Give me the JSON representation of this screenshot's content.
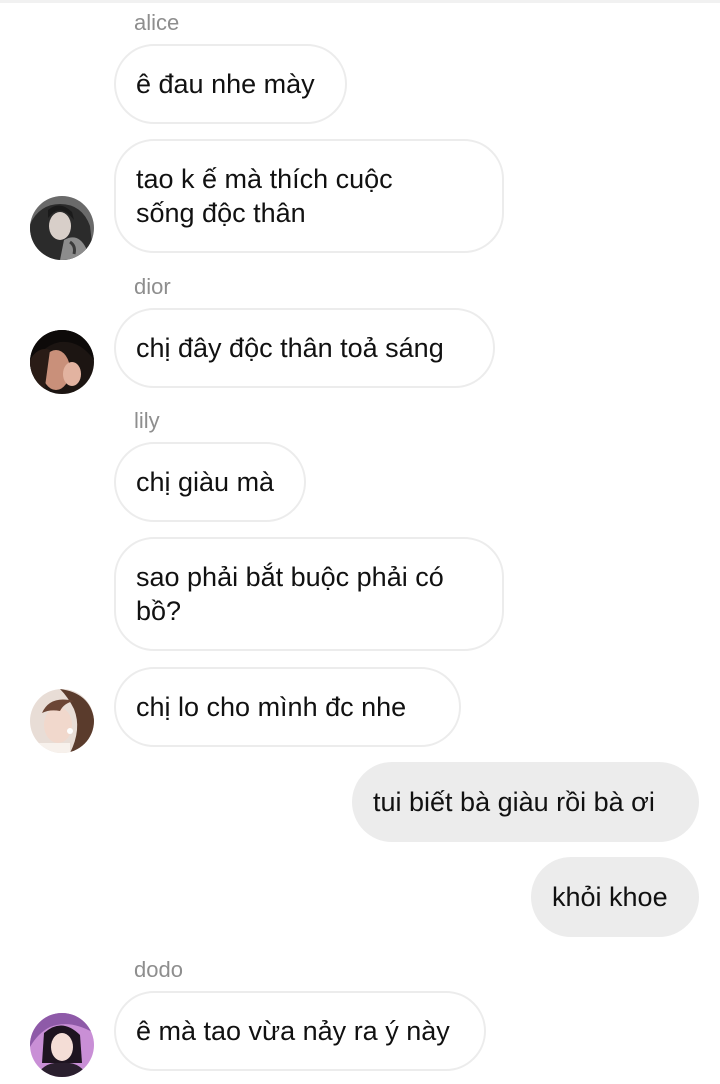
{
  "chat": {
    "messages": [
      {
        "sender": "alice",
        "text": "ê đau nhe mày"
      },
      {
        "text": "tao k ế mà thích cuộc\nsống độc thân"
      },
      {
        "sender": "dior",
        "text": "chị đây độc thân toả sáng"
      },
      {
        "sender": "lily",
        "text": "chị giàu mà"
      },
      {
        "text": "sao phải bắt buộc phải có\nbồ?"
      },
      {
        "text": "chị lo cho mình đc nhe"
      },
      {
        "text": "tui biết bà giàu rồi bà ơi"
      },
      {
        "text": "khỏi khoe"
      },
      {
        "sender": "dodo",
        "text": "ê mà tao vừa nảy ra ý này"
      }
    ]
  },
  "avatars": [
    {
      "icon": "avatar-alice-icon"
    },
    {
      "icon": "avatar-dior-icon"
    },
    {
      "icon": "avatar-lily-icon"
    },
    {
      "icon": "avatar-dodo-icon"
    }
  ],
  "colors": {
    "incoming_bubble_bg": "#ffffff",
    "incoming_bubble_border": "#ececec",
    "outgoing_bubble_bg": "#ececec",
    "sender_name": "#8e8e8e",
    "text": "#111111"
  }
}
